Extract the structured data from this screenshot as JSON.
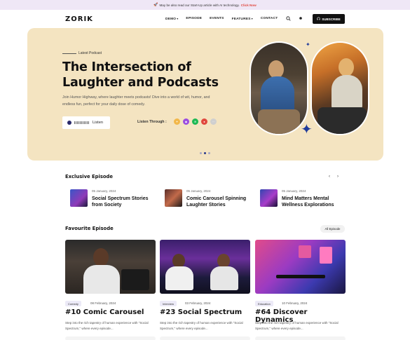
{
  "announcement": {
    "text": "May be also read our Start-Up article with AI technology.",
    "link": "Click Now"
  },
  "header": {
    "logo": "ZORIK",
    "menu": [
      {
        "label": "DEMO",
        "has_caret": true
      },
      {
        "label": "EPISODE",
        "has_caret": false
      },
      {
        "label": "EVENTS",
        "has_caret": false
      },
      {
        "label": "FEATURES",
        "has_caret": true
      },
      {
        "label": "CONTACT",
        "has_caret": false
      }
    ],
    "subscribe_label": "SUBSCRIBE"
  },
  "hero": {
    "eyebrow": "Latest Podcast",
    "title": "The Intersection of Laughter and Podcasts",
    "description": "Join Humor Highway, where laughter meets podcasts! Dive into a world of wit, humor, and endless fun, perfect for your daily dose of comedy.",
    "listen_label": "Listen",
    "listen_through": "Listen Through :",
    "platform_colors": [
      "#f2b84b",
      "#9b4ce0",
      "#1db954",
      "#e0473d",
      "#cfcfcf"
    ],
    "carousel_active": 1,
    "carousel_count": 3
  },
  "exclusive": {
    "title": "Exclusive Episode",
    "episodes": [
      {
        "date": "05 January, 2024",
        "title": "Social Spectrum Stories from Society"
      },
      {
        "date": "05 January, 2024",
        "title": "Comic Carousel Spinning Laughter Stories"
      },
      {
        "date": "05 January, 2024",
        "title": "Mind Matters Mental Wellness Explorations"
      }
    ]
  },
  "favourite": {
    "title": "Favourite Episode",
    "all_label": "All Episode",
    "cards": [
      {
        "tag": "Comedy",
        "date": "08 February, 2024",
        "title": "#10 Comic Carousel",
        "desc": "Step into the rich tapestry of human experience with \"Social Spectrum,\" where every episode..."
      },
      {
        "tag": "Interview",
        "date": "03 February, 2024",
        "title": "#23 Social Spectrum",
        "desc": "Step into the rich tapestry of human experience with \"Social Spectrum,\" where every episode..."
      },
      {
        "tag": "Education",
        "date": "10 February, 2024",
        "title": "#64 Discover Dynamics",
        "desc": "Step into the rich tapestry of human experience with \"Social Spectrum,\" where every episode..."
      }
    ]
  }
}
